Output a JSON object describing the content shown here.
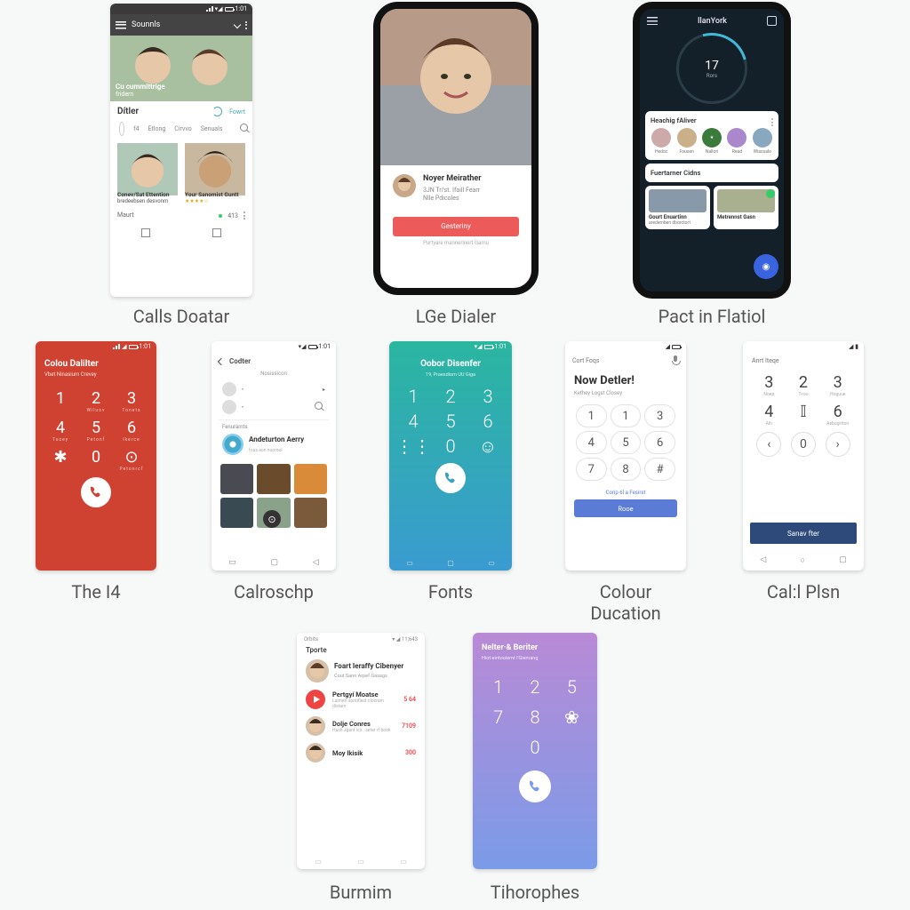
{
  "captions": {
    "s1": "Calls Doatar",
    "s2": "LGe Dialer",
    "s3": "Pact in Flatiol",
    "s4": "The I4",
    "s5": "Calroschp",
    "s6": "Fonts",
    "s7": "Colour Ducation",
    "s8": "Cal:l Plsn",
    "s9": "Burmim",
    "s10": "Tihorophes"
  },
  "s1": {
    "appbar_title": "Sounnls",
    "overlay_title": "Cu cummittrige",
    "overlay_sub": "fridern",
    "section_title": "Dítler",
    "section_action": "Fowrt",
    "tabs": [
      "f4",
      "Etlong",
      "Cirvvo",
      "Senuals"
    ],
    "cards": [
      {
        "title": "Conev/Sat Ettention",
        "sub": "bredeebsen desvonm"
      },
      {
        "title": "Your Sanomist Guntt",
        "sub": "★★★★☆"
      }
    ],
    "meta_left": "Maurt",
    "meta_right": "413"
  },
  "s2": {
    "name": "Noyer Meirather",
    "line1": "3JN Tr/st. Ifaill Fearr",
    "line2": "Nlle Pdicoles",
    "button": "Gesteriny",
    "footer": "Purtyare mannerinert Gamu"
  },
  "s3": {
    "brand": "llanYork",
    "ring_value": "17",
    "ring_unit": "Rors",
    "panel1_title": "Heachig fAliver",
    "panel1_items": [
      "Hedoc",
      "Fousen",
      "Nallori",
      "Read",
      "Wiassalo"
    ],
    "panel2_title": "Fuertarner Cidns",
    "card_a_title": "Gourt Enuartinn",
    "card_a_sub": "aredemben dborctort",
    "card_b_title": "Metrennst Gasn"
  },
  "s4": {
    "title": "Colou Dalilter",
    "subtitle": "Vbet Ninasium Crevey",
    "keys": [
      "1",
      "2",
      "3",
      "4",
      "5",
      "6",
      "✱",
      "0",
      "⊙"
    ],
    "subs": [
      "",
      "Wiluov",
      "Tonets",
      "Tuoey",
      "Petonf",
      "lkerce",
      "",
      "",
      "Petonrcf"
    ]
  },
  "s5": {
    "back_label": "Codter",
    "heading": "Nosissicon",
    "section": "Fenuramts",
    "item": "Andeturton Aerry",
    "item_sub": "fous aon nuoroul",
    "swatches": [
      "#4a4a52",
      "#6a4c2c",
      "#d98b3a",
      "#3a4a52",
      "#8aa18a",
      "#7a5a3a"
    ]
  },
  "s6": {
    "title": "Oobor Disenfer",
    "subtitle": "19, Praesdiom UU Giga",
    "keys": [
      "1",
      "2",
      "3",
      "4",
      "5",
      "6",
      "⋮⋮",
      "0",
      "☺"
    ]
  },
  "s7": {
    "tab": "Cort Foqs",
    "banner_title": "Now Detler!",
    "banner_sub": "Kethey Logst Closey",
    "keys": [
      "1",
      "1",
      "3",
      "4",
      "5",
      "6",
      "7",
      "8",
      "#"
    ],
    "link": "Corip 6l a Fesirst",
    "button": "Rooe"
  },
  "s8": {
    "tab": "Anrt Iteqe",
    "keys": [
      {
        "n": "3",
        "s": "Noep"
      },
      {
        "n": "2",
        "s": "T-rou"
      },
      {
        "n": "3",
        "s": "Hoguue"
      },
      {
        "n": "4",
        "s": "Alh"
      },
      {
        "n": "𝕀",
        "s": ""
      },
      {
        "n": "6",
        "s": "Aebogrtton"
      },
      {
        "n": "‹",
        "s": ""
      },
      {
        "n": "0",
        "s": ""
      },
      {
        "n": "›",
        "s": ""
      }
    ],
    "footer": "Sanav fter"
  },
  "s9": {
    "top_left": "Orbits",
    "time": "▾ ◢ 11;643",
    "title": "Tporte",
    "lead_name": "Foart Ieraffy Cibenyer",
    "lead_sub": "Cout Sann Arpef Gasags",
    "items": [
      {
        "name": "Pertgyí Moatse",
        "sub": "Laimerl sontiflest nlocram distarn",
        "badge": "5 64",
        "play": true
      },
      {
        "name": "Dolje Conres",
        "sub": "Huck Jganf ico · setar rf book",
        "badge": "7109",
        "play": false
      },
      {
        "name": "Moy lkisik",
        "sub": "",
        "badge": "300",
        "play": false
      }
    ]
  },
  "s10": {
    "title": "Nelter·& Beriter",
    "subtitle": "Hiot eintooiernt l'Giemang",
    "keys": [
      "1",
      "2",
      "5",
      "7",
      "8",
      "❀",
      "",
      "0",
      ""
    ]
  }
}
